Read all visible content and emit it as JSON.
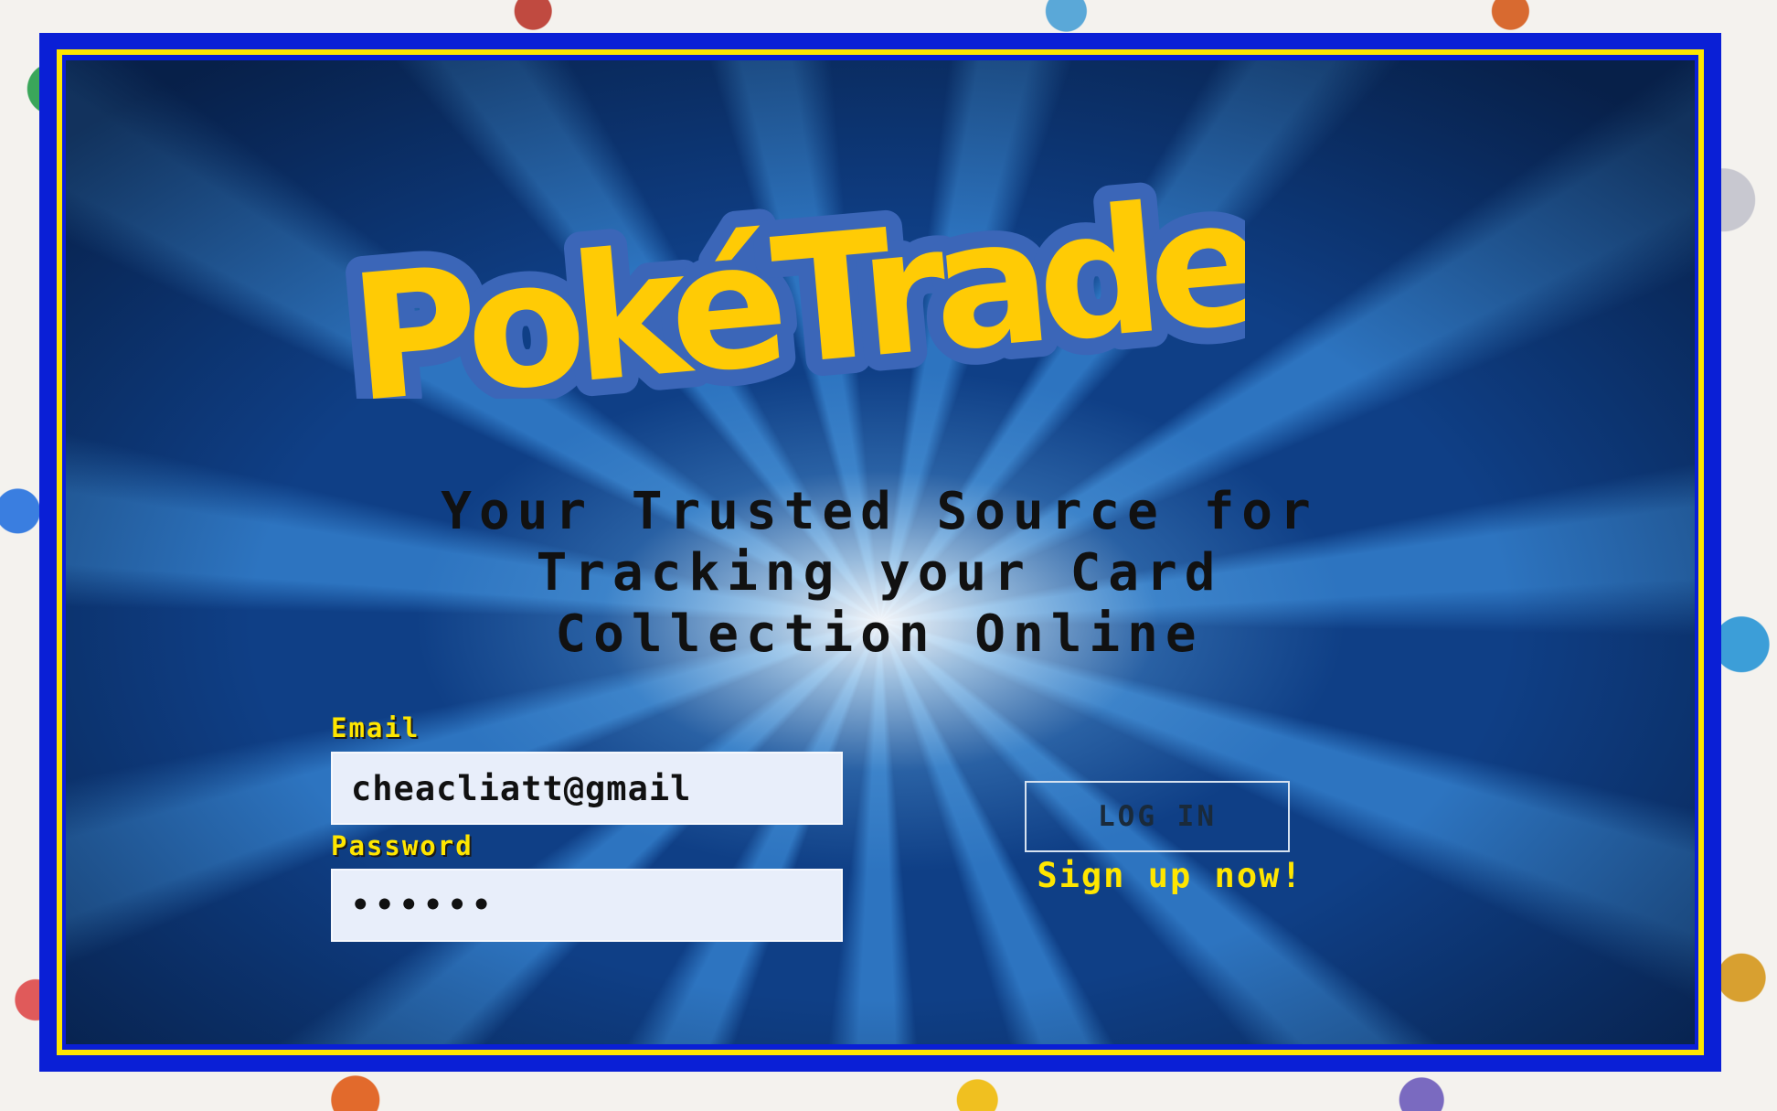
{
  "app": {
    "logo_text": "PokéTrader"
  },
  "hero": {
    "tagline_lines": [
      "Your Trusted Source for",
      "Tracking your Card",
      "Collection Online"
    ]
  },
  "login_form": {
    "email_label": "Email",
    "email_value": "cheacliatt@gmail",
    "password_label": "Password",
    "password_value": "••••••",
    "login_button_label": "LOG IN",
    "signup_link_label": "Sign up now!"
  },
  "colors": {
    "frame_blue": "#0a1fd6",
    "frame_yellow": "#ffe600",
    "logo_yellow": "#ffcb05",
    "logo_outline": "#3b66b8",
    "label_yellow": "#ffe600"
  }
}
